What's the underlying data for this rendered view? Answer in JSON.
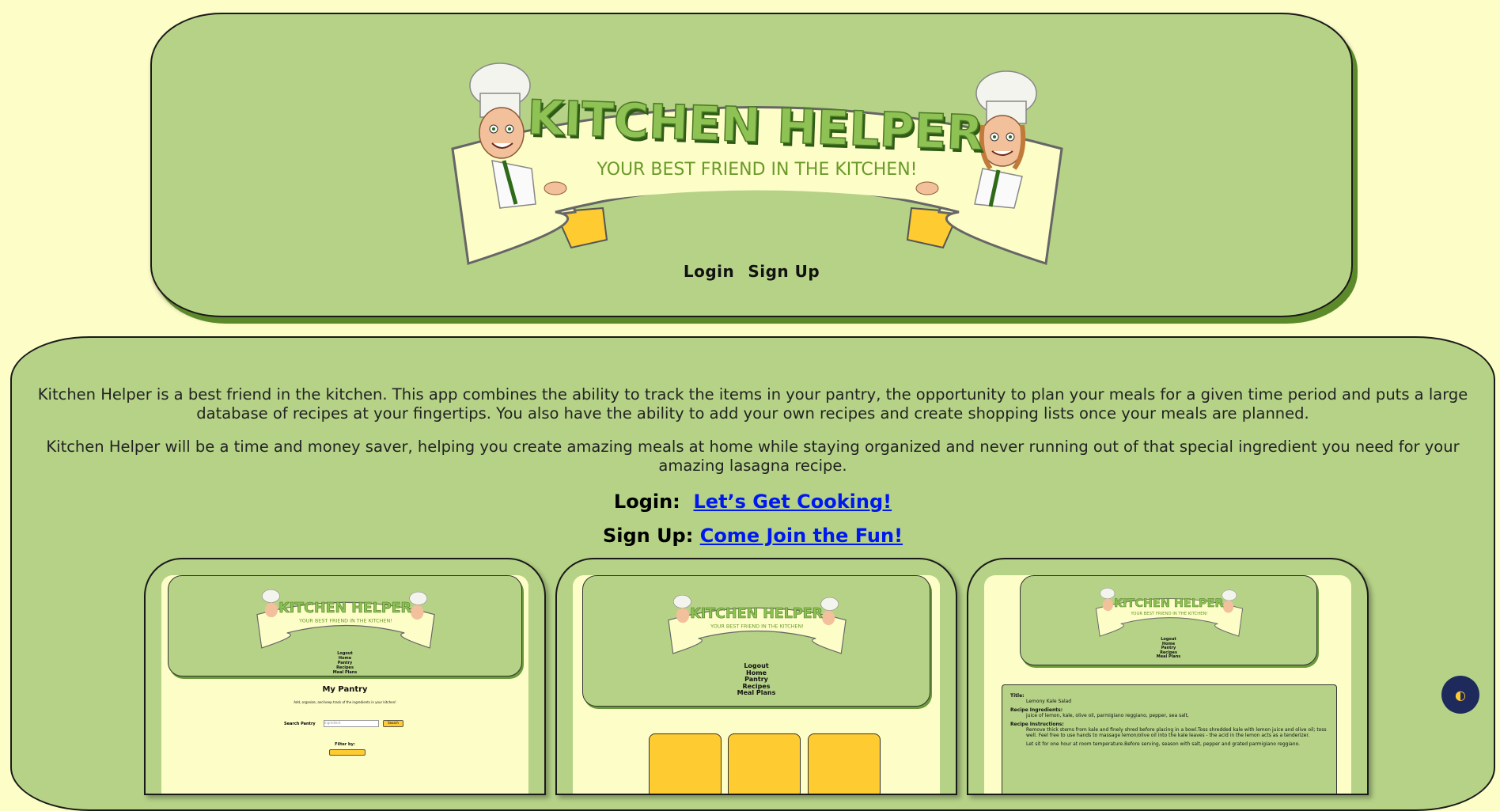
{
  "header": {
    "logo": {
      "title": "KITCHEN HELPER",
      "subtitle": "YOUR BEST FRIEND IN THE KITCHEN!"
    },
    "nav": [
      {
        "label": "Login"
      },
      {
        "label": "Sign Up"
      }
    ]
  },
  "main": {
    "intro_paragraphs": [
      "Kitchen Helper is a best friend in the kitchen. This app combines the ability to track the items in your pantry, the opportunity to plan your meals for a given time period and puts a large database of recipes at your fingertips. You also have the ability to add your own recipes and create shopping lists once your meals are planned.",
      "Kitchen Helper will be a time and money saver, helping you create amazing meals at home while staying organized and never running out of that special ingredient you need for your amazing lasagna recipe."
    ],
    "login_cta": {
      "label": "Login:",
      "link": "Let’s Get Cooking!"
    },
    "signup_cta": {
      "label": "Sign Up:",
      "link": "Come Join the Fun!"
    }
  },
  "previews": {
    "pantry": {
      "nav": [
        "Logout",
        "Home",
        "Pantry",
        "Recipes",
        "Meal Plans"
      ],
      "title": "My Pantry",
      "subtitle": "Add, organize, and keep track of the ingredients in your kitchen!",
      "search_label": "Search Pantry",
      "search_placeholder": "Ingredient",
      "search_button": "Search",
      "filter_label": "Filter by:"
    },
    "home": {
      "nav": [
        "Logout",
        "Home",
        "Pantry",
        "Recipes",
        "Meal Plans"
      ]
    },
    "recipe": {
      "nav": [
        "Logout",
        "Home",
        "Pantry",
        "Recipes",
        "Meal Plans"
      ],
      "title_label": "Title:",
      "title_value": "Lemony Kale Salad",
      "ingredients_label": "Recipe Ingredients:",
      "ingredients_value": "juice of lemon, kale, olive oil, parmigiano reggiano, pepper, sea salt,",
      "instructions_label": "Recipe Instructions:",
      "instructions_value": "Remove thick stems from kale and finely shred before placing in a bowl.Toss shredded kale with lemon juice and olive oil; toss well. Feel free to use hands to massage lemon/olive oil into the kale leaves - the acid in the lemon acts as a tenderizer.",
      "instructions_value2": "Let sit for one hour at room temperature.Before serving, season with salt, pepper and grated parmigiano reggiano."
    }
  },
  "colors": {
    "background": "#fdfdc8",
    "panel": "#b5d287",
    "accent_yellow": "#fecb30",
    "link": "#0018f0",
    "logo_green": "#7fb04a"
  },
  "icons": {
    "theme_toggle": "half-moon-icon"
  }
}
